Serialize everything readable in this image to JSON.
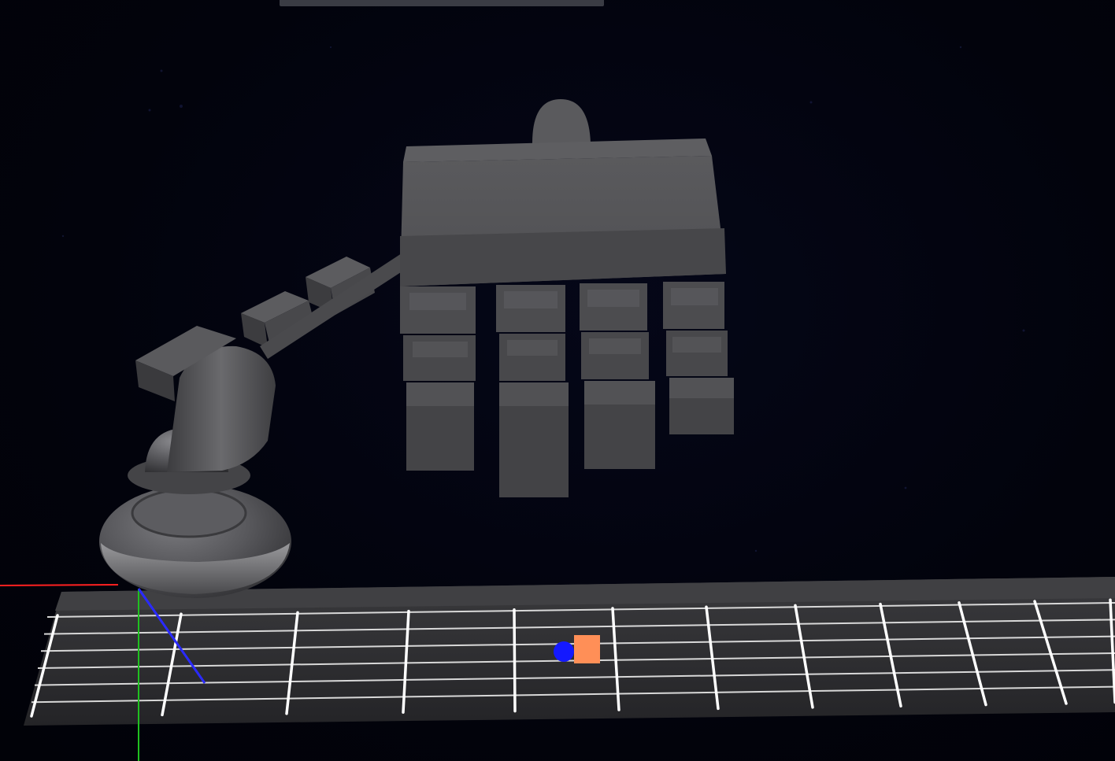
{
  "scene": {
    "background": "#02030d",
    "model_color": "#5a5a5d",
    "fretboard": {
      "color": "#303033",
      "string_count": 6,
      "fret_count": 12,
      "line_color": "#ffffff"
    },
    "markers": {
      "target_color": "#ff8f57",
      "fingertip_color": "#1419ff"
    },
    "axes": {
      "x_color": "#ff2020",
      "y_color": "#20c020",
      "z_color": "#2a2aff"
    },
    "top_bar_color": "#3a3c44"
  }
}
